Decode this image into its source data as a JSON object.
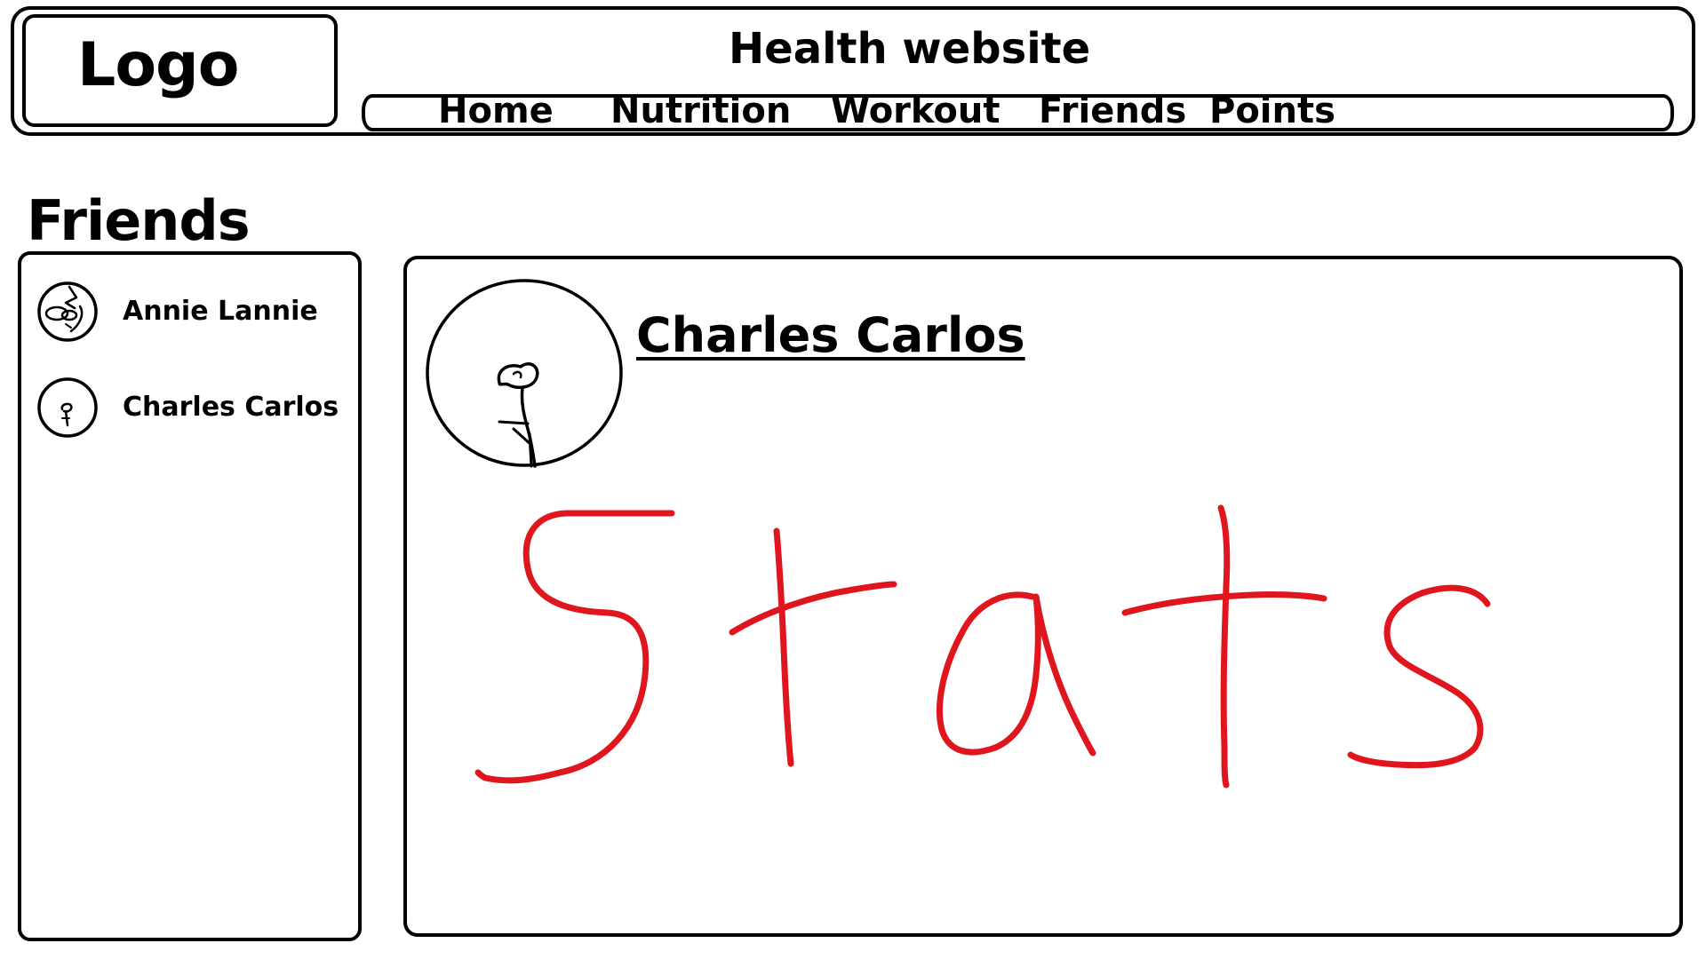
{
  "header": {
    "logo_text": "Logo",
    "site_title": "Health website",
    "nav": [
      {
        "label": "Home"
      },
      {
        "label": "Nutrition"
      },
      {
        "label": "Workout"
      },
      {
        "label": "Friends"
      },
      {
        "label": "Points"
      }
    ]
  },
  "friends": {
    "heading": "Friends",
    "list": [
      {
        "name": "Annie Lannie",
        "avatar_icon": "sketch-face-avatar-icon"
      },
      {
        "name": "Charles Carlos",
        "avatar_icon": "sketch-figure-avatar-icon"
      }
    ]
  },
  "profile": {
    "name": "Charles Carlos",
    "avatar_icon": "sketch-stick-figure-avatar-icon",
    "stats_text": "Stats",
    "stats_color": "#e0161f"
  }
}
